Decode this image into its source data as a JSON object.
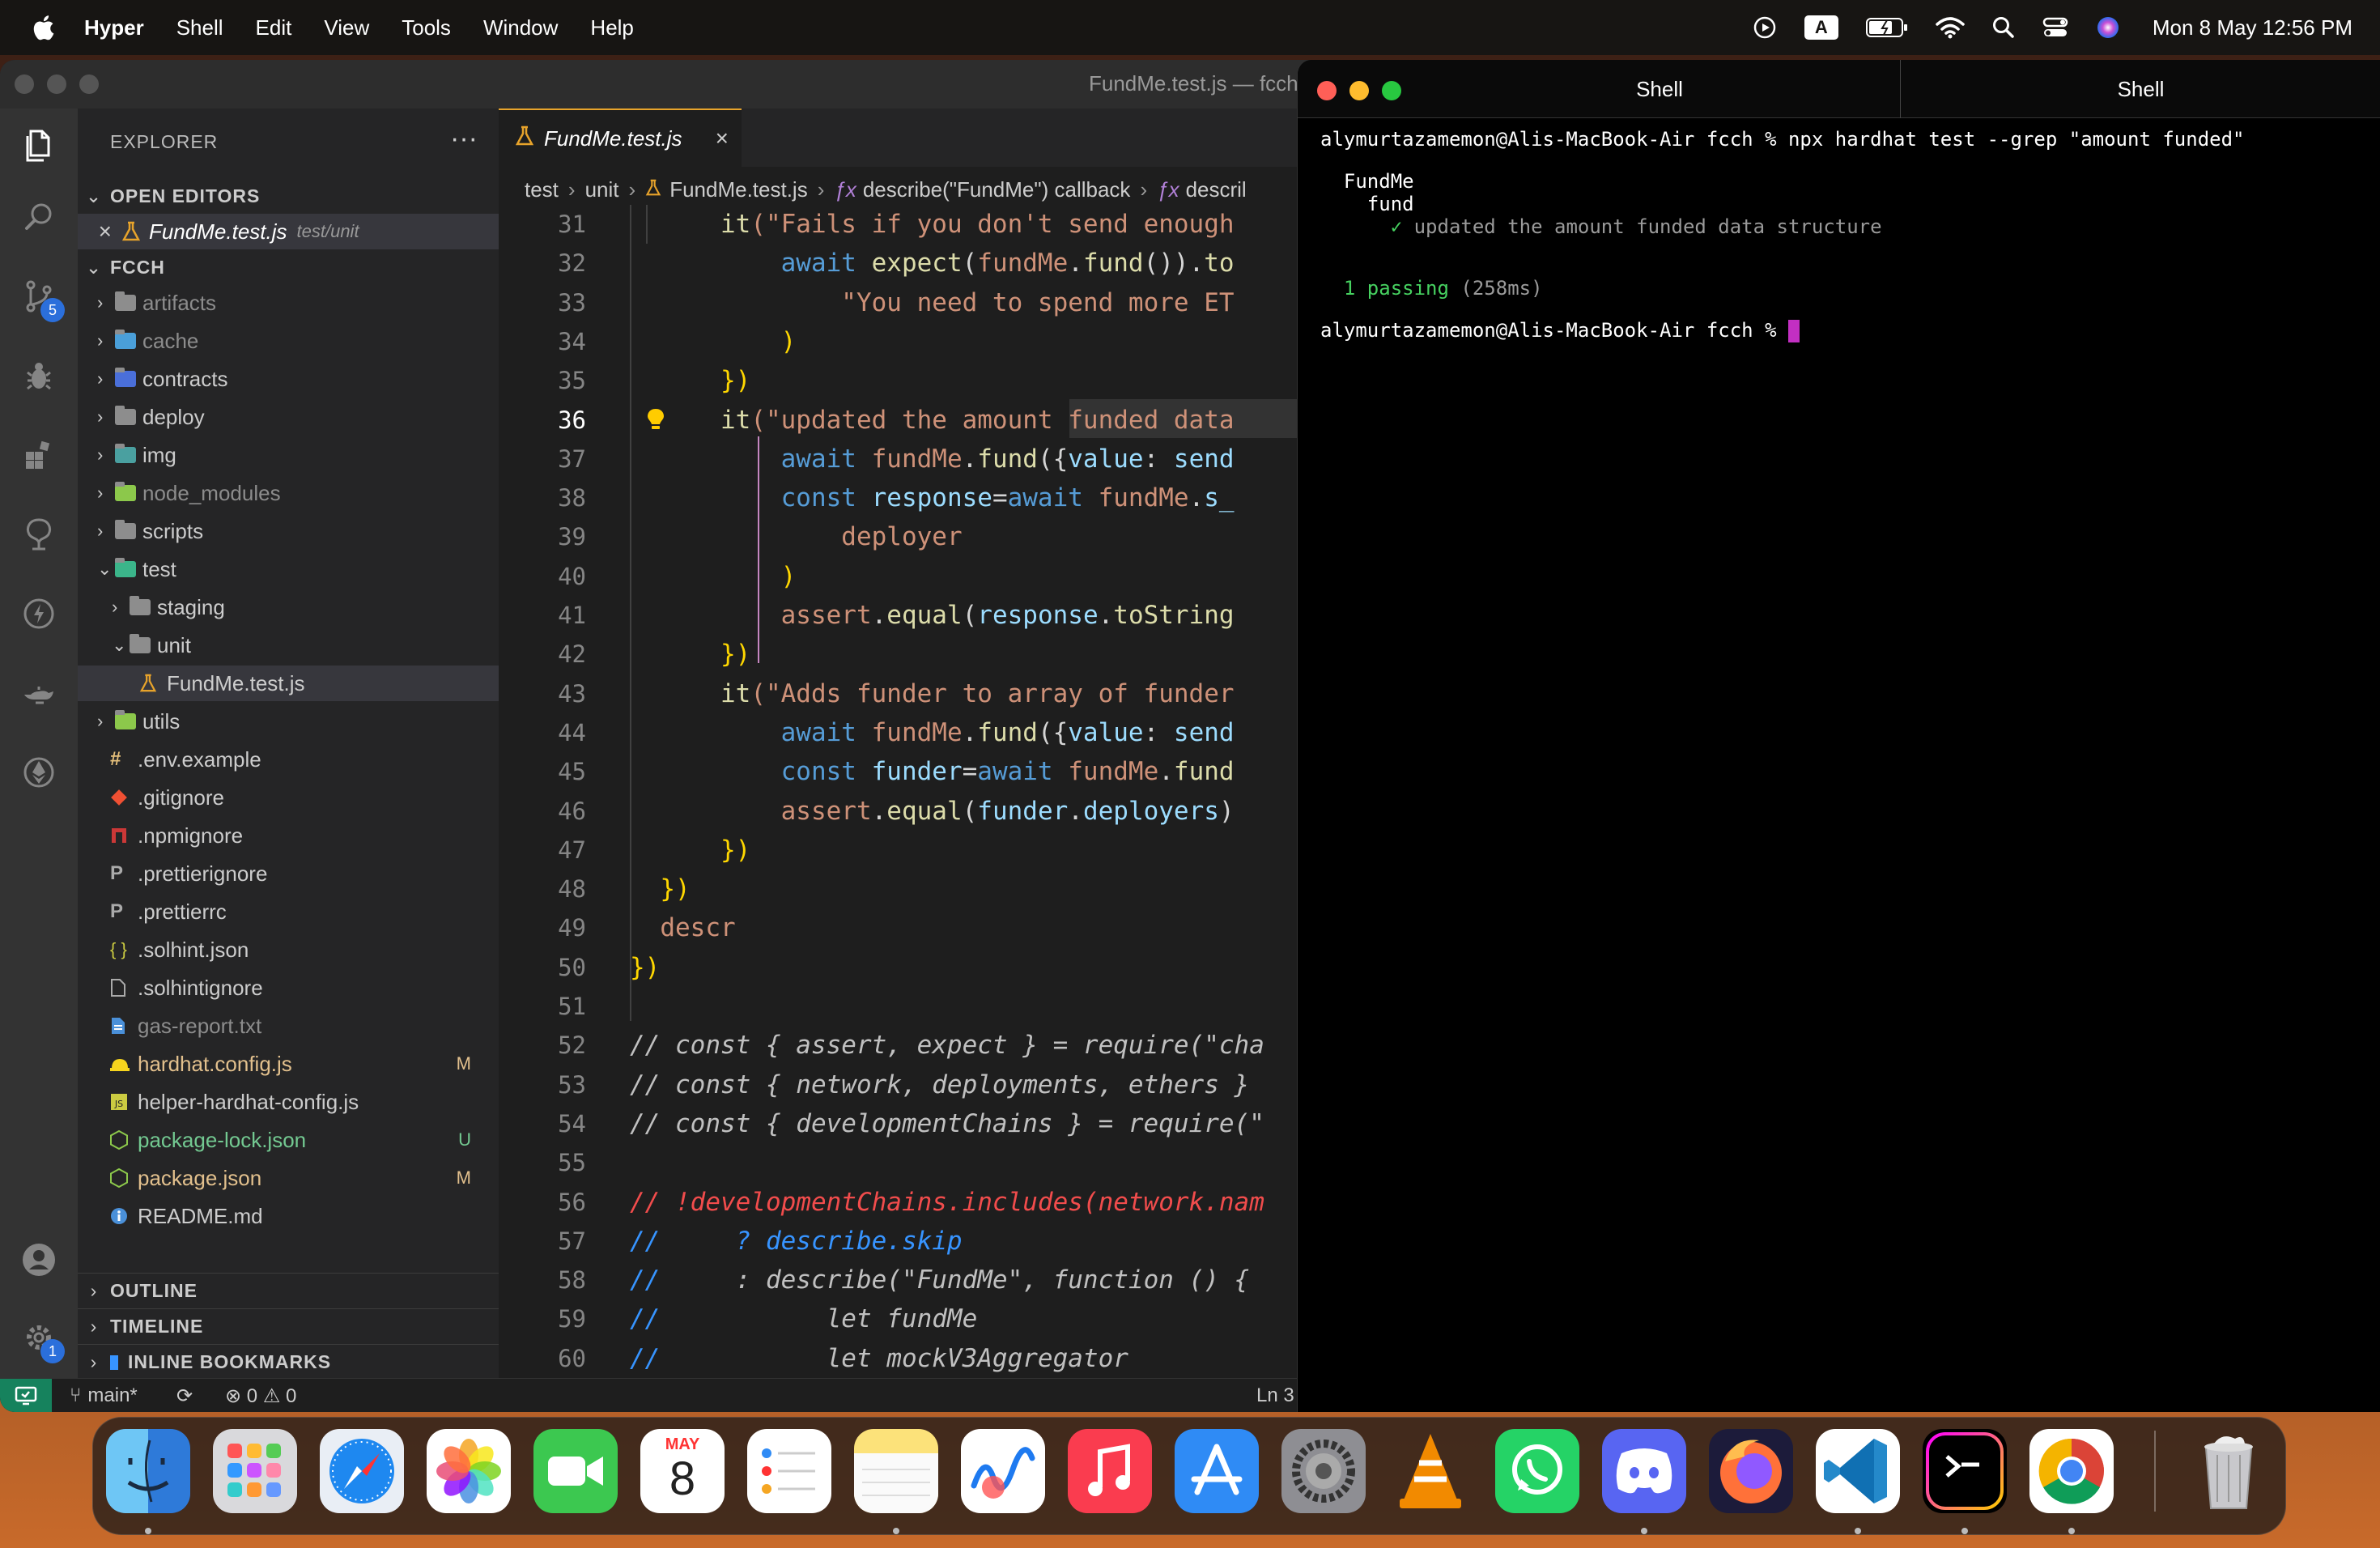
{
  "menubar": {
    "app_name": "Hyper",
    "menus": [
      "Shell",
      "Edit",
      "View",
      "Tools",
      "Window",
      "Help"
    ],
    "keyboard_input": "A",
    "clock": "Mon 8 May  12:56 PM"
  },
  "vscode": {
    "window_title": "FundMe.test.js — fcch",
    "explorer_title": "EXPLORER",
    "explorer_more": "···",
    "source_control_badge": "5",
    "settings_badge": "1",
    "open_editors_label": "OPEN EDITORS",
    "open_editor": {
      "name": "FundMe.test.js",
      "path": "test/unit",
      "close": "×"
    },
    "project_label": "FCCH",
    "tree": [
      {
        "name": "artifacts",
        "type": "folder",
        "depth": 0,
        "dim": true,
        "status": ""
      },
      {
        "name": "cache",
        "type": "folder",
        "depth": 0,
        "dim": true,
        "status": ""
      },
      {
        "name": "contracts",
        "type": "folder",
        "depth": 0,
        "dim": false,
        "status": ""
      },
      {
        "name": "deploy",
        "type": "folder",
        "depth": 0,
        "dim": false,
        "status": ""
      },
      {
        "name": "img",
        "type": "folder",
        "depth": 0,
        "dim": false,
        "status": ""
      },
      {
        "name": "node_modules",
        "type": "folder",
        "depth": 0,
        "dim": true,
        "status": ""
      },
      {
        "name": "scripts",
        "type": "folder",
        "depth": 0,
        "dim": false,
        "status": ""
      },
      {
        "name": "test",
        "type": "folder-open",
        "depth": 0,
        "dim": false,
        "status": ""
      },
      {
        "name": "staging",
        "type": "folder",
        "depth": 1,
        "dim": false,
        "status": ""
      },
      {
        "name": "unit",
        "type": "folder-open",
        "depth": 1,
        "dim": false,
        "status": ""
      },
      {
        "name": "FundMe.test.js",
        "type": "file-test",
        "depth": 2,
        "dim": false,
        "status": ""
      },
      {
        "name": "utils",
        "type": "folder",
        "depth": 0,
        "dim": false,
        "status": ""
      },
      {
        "name": ".env.example",
        "type": "file-env",
        "depth": 0,
        "dim": false,
        "status": ""
      },
      {
        "name": ".gitignore",
        "type": "file-git",
        "depth": 0,
        "dim": false,
        "status": ""
      },
      {
        "name": ".npmignore",
        "type": "file-npm",
        "depth": 0,
        "dim": false,
        "status": ""
      },
      {
        "name": ".prettierignore",
        "type": "file-prettier",
        "depth": 0,
        "dim": false,
        "status": ""
      },
      {
        "name": ".prettierrc",
        "type": "file-prettier",
        "depth": 0,
        "dim": false,
        "status": ""
      },
      {
        "name": ".solhint.json",
        "type": "file-json",
        "depth": 0,
        "dim": false,
        "status": ""
      },
      {
        "name": ".solhintignore",
        "type": "file-plain",
        "depth": 0,
        "dim": false,
        "status": ""
      },
      {
        "name": "gas-report.txt",
        "type": "file-txt",
        "depth": 0,
        "dim": true,
        "status": ""
      },
      {
        "name": "hardhat.config.js",
        "type": "file-hardhat",
        "depth": 0,
        "dim": false,
        "status": "M"
      },
      {
        "name": "helper-hardhat-config.js",
        "type": "file-js",
        "depth": 0,
        "dim": false,
        "status": ""
      },
      {
        "name": "package-lock.json",
        "type": "file-node",
        "depth": 0,
        "dim": false,
        "status": "U"
      },
      {
        "name": "package.json",
        "type": "file-node",
        "depth": 0,
        "dim": false,
        "status": "M"
      },
      {
        "name": "README.md",
        "type": "file-info",
        "depth": 0,
        "dim": false,
        "status": ""
      }
    ],
    "outline_label": "OUTLINE",
    "timeline_label": "TIMELINE",
    "bookmarks_label": "INLINE BOOKMARKS",
    "tab": {
      "name": "FundMe.test.js",
      "close": "×"
    },
    "breadcrumbs": [
      "test",
      "unit",
      "FundMe.test.js",
      "describe(\"FundMe\") callback",
      "descril"
    ],
    "current_line": 36,
    "code_lines": [
      {
        "n": 31,
        "tokens": [
          [
            "      ",
            "t"
          ],
          [
            "it",
            "fn"
          ],
          [
            "(\"Fails if you don't send enough",
            "str"
          ]
        ]
      },
      {
        "n": 32,
        "tokens": [
          [
            "          ",
            "t"
          ],
          [
            "await ",
            "kw"
          ],
          [
            "expect",
            "fn"
          ],
          [
            "(",
            "t"
          ],
          [
            "fundMe",
            "str"
          ],
          [
            ".",
            "t"
          ],
          [
            "fund",
            "fn"
          ],
          [
            "()).",
            "t"
          ],
          [
            "to",
            "fn"
          ]
        ]
      },
      {
        "n": 33,
        "tokens": [
          [
            "              ",
            "t"
          ],
          [
            "\"You need to spend more ET",
            "str"
          ]
        ]
      },
      {
        "n": 34,
        "tokens": [
          [
            "          ",
            "t"
          ],
          [
            ")",
            "brace"
          ]
        ]
      },
      {
        "n": 35,
        "tokens": [
          [
            "      ",
            "t"
          ],
          [
            "})",
            "brace"
          ]
        ]
      },
      {
        "n": 36,
        "tokens": [
          [
            "      ",
            "t"
          ],
          [
            "it",
            "fn"
          ],
          [
            "(\"updated the amount funded data",
            "str"
          ]
        ]
      },
      {
        "n": 37,
        "tokens": [
          [
            "          ",
            "t"
          ],
          [
            "await ",
            "kw"
          ],
          [
            "fundMe",
            "str"
          ],
          [
            ".",
            "t"
          ],
          [
            "fund",
            "fn"
          ],
          [
            "({",
            "t"
          ],
          [
            "value",
            "var"
          ],
          [
            ": ",
            "t"
          ],
          [
            "send",
            "var"
          ]
        ]
      },
      {
        "n": 38,
        "tokens": [
          [
            "          ",
            "t"
          ],
          [
            "const ",
            "kw"
          ],
          [
            "response",
            "var"
          ],
          [
            "=",
            "t"
          ],
          [
            "await ",
            "kw"
          ],
          [
            "fundMe",
            "str"
          ],
          [
            ".",
            "t"
          ],
          [
            "s_",
            "var"
          ]
        ]
      },
      {
        "n": 39,
        "tokens": [
          [
            "              ",
            "t"
          ],
          [
            "deployer",
            "str"
          ]
        ]
      },
      {
        "n": 40,
        "tokens": [
          [
            "          ",
            "t"
          ],
          [
            ")",
            "brace"
          ]
        ]
      },
      {
        "n": 41,
        "tokens": [
          [
            "          ",
            "t"
          ],
          [
            "assert",
            "str"
          ],
          [
            ".",
            "t"
          ],
          [
            "equal",
            "fn"
          ],
          [
            "(",
            "t"
          ],
          [
            "response",
            "var"
          ],
          [
            ".",
            "t"
          ],
          [
            "toString",
            "fn"
          ]
        ]
      },
      {
        "n": 42,
        "tokens": [
          [
            "      ",
            "t"
          ],
          [
            "})",
            "brace"
          ]
        ]
      },
      {
        "n": 43,
        "tokens": [
          [
            "      ",
            "t"
          ],
          [
            "it",
            "fn"
          ],
          [
            "(\"Adds funder to array of funder",
            "str"
          ]
        ]
      },
      {
        "n": 44,
        "tokens": [
          [
            "          ",
            "t"
          ],
          [
            "await ",
            "kw"
          ],
          [
            "fundMe",
            "str"
          ],
          [
            ".",
            "t"
          ],
          [
            "fund",
            "fn"
          ],
          [
            "({",
            "t"
          ],
          [
            "value",
            "var"
          ],
          [
            ": ",
            "t"
          ],
          [
            "send",
            "var"
          ]
        ]
      },
      {
        "n": 45,
        "tokens": [
          [
            "          ",
            "t"
          ],
          [
            "const ",
            "kw"
          ],
          [
            "funder",
            "var"
          ],
          [
            "=",
            "t"
          ],
          [
            "await ",
            "kw"
          ],
          [
            "fundMe",
            "str"
          ],
          [
            ".",
            "t"
          ],
          [
            "fund",
            "fn"
          ]
        ]
      },
      {
        "n": 46,
        "tokens": [
          [
            "          ",
            "t"
          ],
          [
            "assert",
            "str"
          ],
          [
            ".",
            "t"
          ],
          [
            "equal",
            "fn"
          ],
          [
            "(",
            "t"
          ],
          [
            "funder",
            "var"
          ],
          [
            ".",
            "t"
          ],
          [
            "deployers",
            "var"
          ],
          [
            ")",
            "t"
          ]
        ]
      },
      {
        "n": 47,
        "tokens": [
          [
            "      ",
            "t"
          ],
          [
            "})",
            "brace"
          ]
        ]
      },
      {
        "n": 48,
        "tokens": [
          [
            "  ",
            "t"
          ],
          [
            "})",
            "brace"
          ]
        ]
      },
      {
        "n": 49,
        "tokens": [
          [
            "  ",
            "t"
          ],
          [
            "descr",
            "str"
          ]
        ]
      },
      {
        "n": 50,
        "tokens": [
          [
            "})",
            "brace"
          ]
        ]
      },
      {
        "n": 51,
        "tokens": []
      },
      {
        "n": 52,
        "tokens": [
          [
            "// const { assert, expect } = require(\"cha",
            "cm2"
          ]
        ]
      },
      {
        "n": 53,
        "tokens": [
          [
            "// const { network, deployments, ethers }",
            "cm2"
          ]
        ]
      },
      {
        "n": 54,
        "tokens": [
          [
            "// const { developmentChains } = require(\"",
            "cm2"
          ]
        ]
      },
      {
        "n": 55,
        "tokens": []
      },
      {
        "n": 56,
        "tokens": [
          [
            "// !developmentChains.includes(network.nam",
            "cmred"
          ]
        ]
      },
      {
        "n": 57,
        "tokens": [
          [
            "//",
            "cmblue"
          ],
          [
            "     ? describe.skip",
            "cmblue"
          ]
        ]
      },
      {
        "n": 58,
        "tokens": [
          [
            "//",
            "cmblue"
          ],
          [
            "     : describe(\"FundMe\", function () {",
            "cm2"
          ]
        ]
      },
      {
        "n": 59,
        "tokens": [
          [
            "//",
            "cmblue"
          ],
          [
            "           let fundMe",
            "cm2"
          ]
        ]
      },
      {
        "n": 60,
        "tokens": [
          [
            "//",
            "cmblue"
          ],
          [
            "           let mockV3Aggregator",
            "cm2"
          ]
        ]
      }
    ],
    "status": {
      "branch": "main*",
      "errors": "0",
      "warnings": "0",
      "position": "Ln 3"
    }
  },
  "hyper": {
    "tabs": [
      "Shell",
      "Shell"
    ],
    "lines": [
      {
        "text": "alymurtazamemon@Alis-MacBook-Air fcch % npx hardhat test --grep \"amount funded\"",
        "style": "prompt"
      },
      {
        "text": "",
        "style": "plain"
      },
      {
        "text": "  FundMe",
        "style": "plain"
      },
      {
        "text": "    fund",
        "style": "plain"
      },
      {
        "text": "      ✓ updated the amount funded data structure",
        "style": "check"
      },
      {
        "text": "",
        "style": "plain"
      },
      {
        "text": "",
        "style": "plain"
      },
      {
        "text": "  1 passing",
        "style": "pass",
        "extra": " (258ms)"
      },
      {
        "text": "",
        "style": "plain"
      },
      {
        "text": "alymurtazamemon@Alis-MacBook-Air fcch % ",
        "style": "prompt-cursor"
      }
    ]
  },
  "dock": {
    "calendar_month": "MAY",
    "calendar_day": "8",
    "apps": [
      "finder-icon",
      "launchpad-icon",
      "safari-icon",
      "photos-icon",
      "facetime-icon",
      "calendar-icon",
      "reminders-icon",
      "notes-icon",
      "freeform-icon",
      "music-icon",
      "app-store-icon",
      "system-settings-icon",
      "vlc-icon",
      "whatsapp-icon",
      "discord-icon",
      "firefox-icon",
      "vscode-icon",
      "hyper-icon",
      "chrome-icon"
    ]
  },
  "colors": {
    "vscode_bg": "#1e1e1e",
    "sidebar_bg": "#252526",
    "activity_bg": "#333333",
    "accent_tab": "#e7a32b",
    "modified": "#e2c08d",
    "untracked": "#73c991",
    "terminal_bg": "#000000",
    "cursor": "#c22fc2",
    "pass_green": "#46d160"
  }
}
